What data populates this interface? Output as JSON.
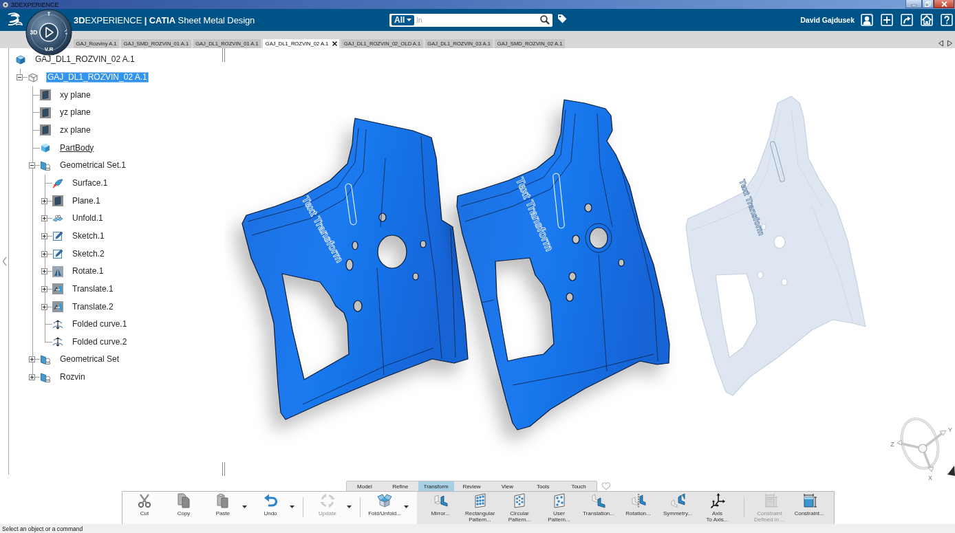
{
  "title_bar": {
    "title": "3DEXPERIENCE"
  },
  "app_bar": {
    "compass_labels": [
      "3D",
      "V.R"
    ],
    "title": "**3D**EXPERIENCE **| CATIA** Sheet Metal Design",
    "search": {
      "scope": "All",
      "placeholder": "In"
    },
    "user_name": "David Gajdusek"
  },
  "document_tabs": [
    {
      "label": "GAJ_Rozviny A.1",
      "selected": false
    },
    {
      "label": "GAJ_SMD_ROZVIN_01 A.1",
      "selected": false
    },
    {
      "label": "GAJ_DL1_ROZVIN_01 A.1",
      "selected": false
    },
    {
      "label": "GAJ_DL1_ROZVIN_02 A.1",
      "selected": true
    },
    {
      "label": "GAJ_DL1_ROZVIN_02_OLD A.1",
      "selected": false
    },
    {
      "label": "GAJ_DL1_ROZVIN_03 A.1",
      "selected": false
    },
    {
      "label": "GAJ_SMD_ROZVIN_02 A.1",
      "selected": false
    }
  ],
  "tree": {
    "items": [
      {
        "label": "GAJ_DL1_ROZVIN_02 A.1",
        "kind": "product",
        "selected": false,
        "in_work": false,
        "children": [
          {
            "label": "GAJ_DL1_ROZVIN_02 A.1",
            "kind": "part",
            "expanded": true,
            "selected": true,
            "in_work": false,
            "children": [
              {
                "label": "xy plane",
                "kind": "plane",
                "selected": false,
                "in_work": false
              },
              {
                "label": "yz plane",
                "kind": "plane",
                "selected": false,
                "in_work": false
              },
              {
                "label": "zx plane",
                "kind": "plane",
                "selected": false,
                "in_work": false
              },
              {
                "label": "PartBody",
                "kind": "body",
                "selected": false,
                "in_work": true
              },
              {
                "label": "Geometrical Set.1",
                "kind": "set",
                "expanded": true,
                "selected": false,
                "in_work": false,
                "children": [
                  {
                    "label": "Surface.1",
                    "kind": "surface",
                    "selected": false,
                    "in_work": false
                  },
                  {
                    "label": "Plane.1",
                    "kind": "plane",
                    "expanded": false,
                    "selected": false,
                    "in_work": false
                  },
                  {
                    "label": "Unfold.1",
                    "kind": "unfold",
                    "expanded": false,
                    "selected": false,
                    "in_work": false
                  },
                  {
                    "label": "Sketch.1",
                    "kind": "sketch",
                    "expanded": false,
                    "selected": false,
                    "in_work": false
                  },
                  {
                    "label": "Sketch.2",
                    "kind": "sketch",
                    "expanded": false,
                    "selected": false,
                    "in_work": false
                  },
                  {
                    "label": "Rotate.1",
                    "kind": "rotate",
                    "expanded": false,
                    "selected": false,
                    "in_work": false
                  },
                  {
                    "label": "Translate.1",
                    "kind": "translate",
                    "expanded": false,
                    "selected": false,
                    "in_work": false
                  },
                  {
                    "label": "Translate.2",
                    "kind": "translate",
                    "expanded": false,
                    "selected": false,
                    "in_work": false
                  },
                  {
                    "label": "Folded curve.1",
                    "kind": "curve",
                    "selected": false,
                    "in_work": false
                  },
                  {
                    "label": "Folded curve.2",
                    "kind": "curve",
                    "selected": false,
                    "in_work": false
                  }
                ]
              },
              {
                "label": "Geometrical Set",
                "kind": "set",
                "expanded": false,
                "selected": false,
                "in_work": false
              },
              {
                "label": "Rozvin",
                "kind": "set",
                "expanded": false,
                "selected": false,
                "in_work": false
              }
            ]
          }
        ]
      }
    ]
  },
  "viewport": {
    "parts": [
      {
        "engraving": "Text Transform",
        "ghosted": false
      },
      {
        "engraving": "Text Transform",
        "ghosted": false
      },
      {
        "engraving": "Text Transform",
        "ghosted": true
      }
    ],
    "compass_axes": [
      "Y",
      "Z",
      "X"
    ]
  },
  "action_bar": {
    "tabs": [
      {
        "label": "Model",
        "selected": false
      },
      {
        "label": "Refine",
        "selected": false
      },
      {
        "label": "Transform",
        "selected": true
      },
      {
        "label": "Review",
        "selected": false
      },
      {
        "label": "View",
        "selected": false
      },
      {
        "label": "Tools",
        "selected": false
      },
      {
        "label": "Touch",
        "selected": false
      }
    ],
    "toolbar": {
      "sections": [
        {
          "kind": "common",
          "groups": [
            {
              "buttons": [
                {
                  "lines": [
                    "Cut"
                  ],
                  "kind": "cut",
                  "dropdown": false,
                  "disabled": false
                },
                {
                  "lines": [
                    "Copy"
                  ],
                  "kind": "copy",
                  "dropdown": false,
                  "disabled": false
                },
                {
                  "lines": [
                    "Paste"
                  ],
                  "kind": "paste",
                  "dropdown": true,
                  "disabled": false
                },
                {
                  "lines": [
                    "Undo"
                  ],
                  "kind": "undo",
                  "dropdown": true,
                  "disabled": false
                }
              ]
            },
            {
              "buttons": [
                {
                  "lines": [
                    "Update"
                  ],
                  "kind": "update",
                  "dropdown": true,
                  "disabled": true
                }
              ]
            },
            {
              "buttons": [
                {
                  "lines": [
                    "Fold/Unfold..."
                  ],
                  "kind": "fold",
                  "dropdown": true,
                  "disabled": false
                }
              ]
            }
          ]
        },
        {
          "kind": "workbench",
          "groups": [
            {
              "buttons": [
                {
                  "lines": [
                    "Mirror..."
                  ],
                  "kind": "mirror",
                  "dropdown": false,
                  "disabled": false
                },
                {
                  "lines": [
                    "Rectangular",
                    "Pattern..."
                  ],
                  "kind": "rect_pattern",
                  "dropdown": false,
                  "disabled": false
                },
                {
                  "lines": [
                    "Circular",
                    "Pattern..."
                  ],
                  "kind": "circ_pattern",
                  "dropdown": false,
                  "disabled": false
                },
                {
                  "lines": [
                    "User",
                    "Pattern..."
                  ],
                  "kind": "user_pattern",
                  "dropdown": false,
                  "disabled": false
                },
                {
                  "lines": [
                    "Translation..."
                  ],
                  "kind": "translation",
                  "dropdown": false,
                  "disabled": false
                },
                {
                  "lines": [
                    "Rotation..."
                  ],
                  "kind": "rotation",
                  "dropdown": false,
                  "disabled": false
                },
                {
                  "lines": [
                    "Symmetry..."
                  ],
                  "kind": "symmetry",
                  "dropdown": false,
                  "disabled": false
                },
                {
                  "lines": [
                    "Axis",
                    "To Axis..."
                  ],
                  "kind": "axis",
                  "dropdown": false,
                  "disabled": false
                }
              ]
            },
            {
              "buttons": [
                {
                  "lines": [
                    "Constraint",
                    "Defined in ..."
                  ],
                  "kind": "constraint_defined",
                  "dropdown": false,
                  "disabled": true
                },
                {
                  "lines": [
                    "Constraint..."
                  ],
                  "kind": "constraint",
                  "dropdown": false,
                  "disabled": false
                }
              ]
            }
          ]
        }
      ]
    }
  },
  "status_bar": {
    "message": "Select an object or a command"
  }
}
